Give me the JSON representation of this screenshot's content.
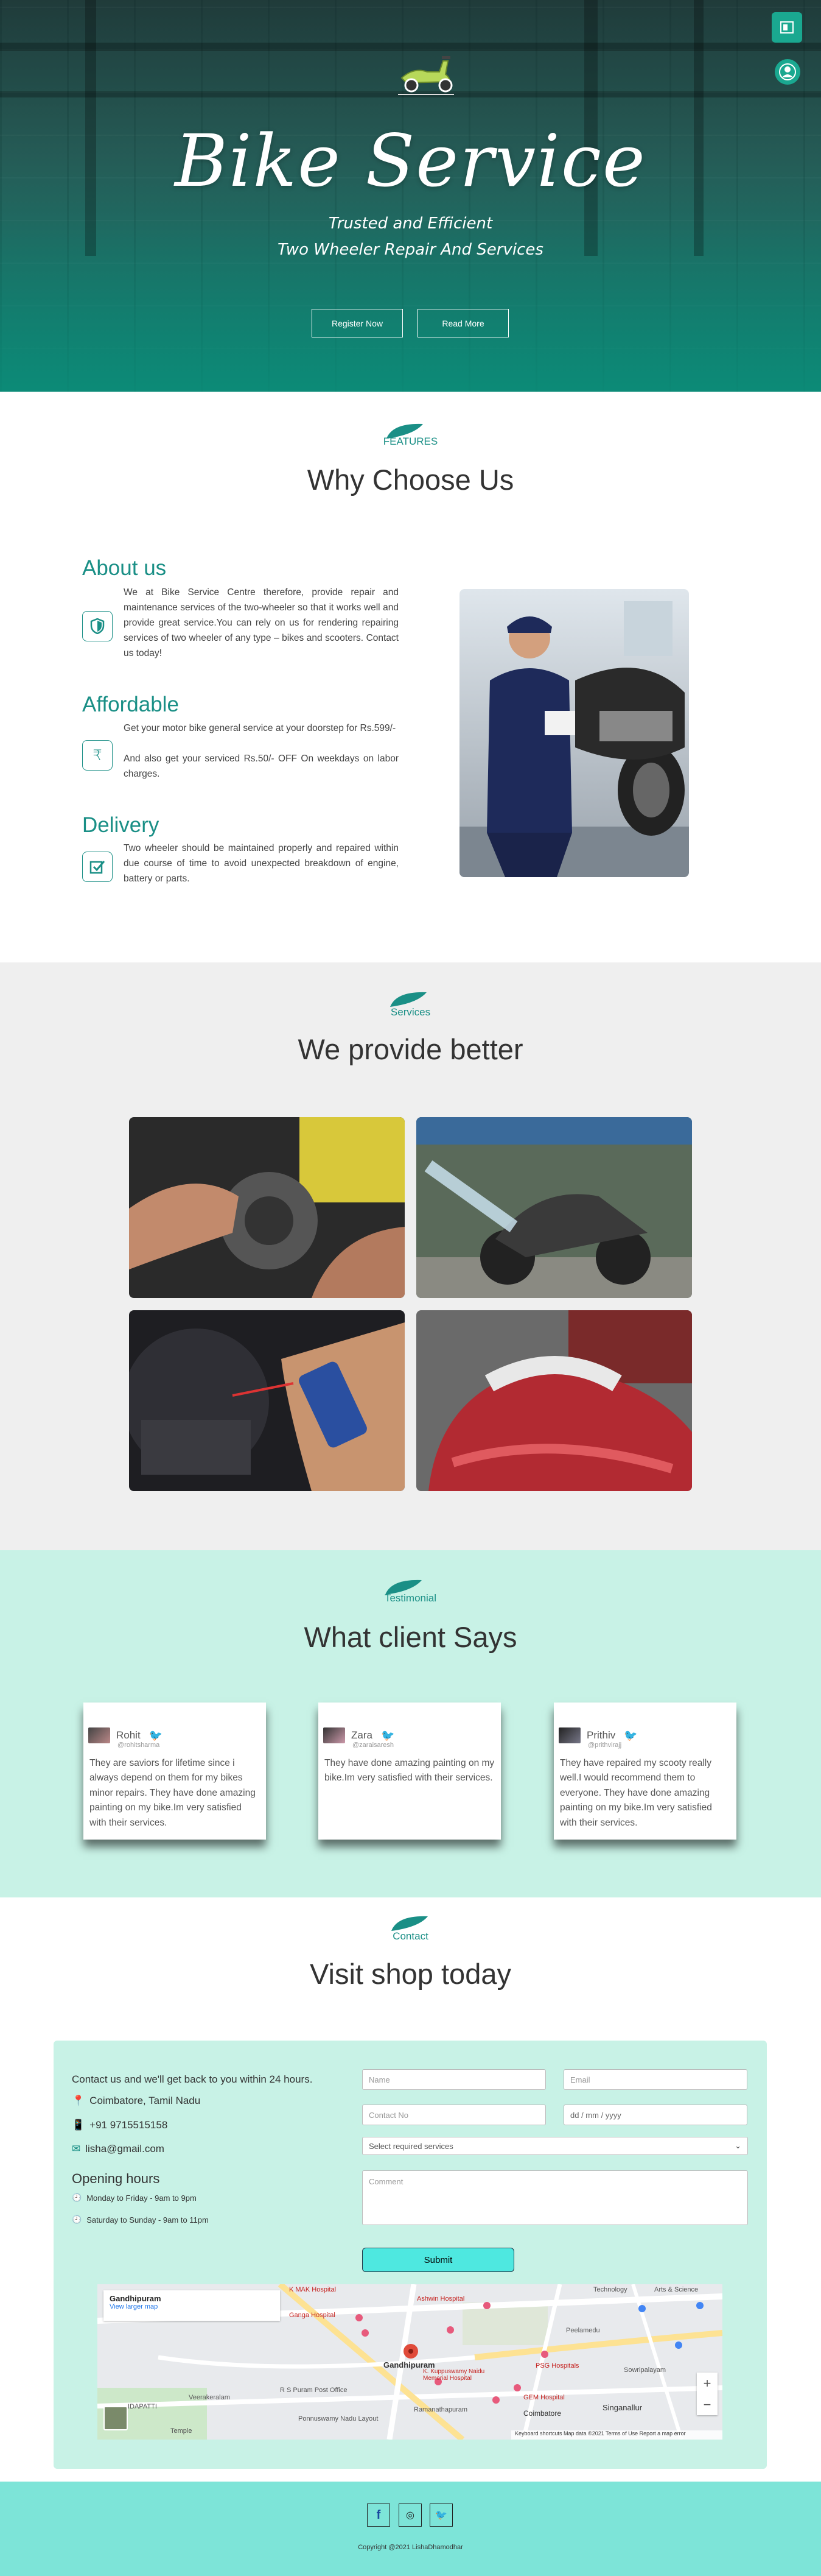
{
  "hero": {
    "title": "Bike Service",
    "subtitle_1": "Trusted and Efficient",
    "subtitle_2": "Two Wheeler Repair And Services",
    "register_button": "Register Now",
    "read_more_button": "Read More",
    "side_buttons": [
      "sidebar-toggle-icon",
      "user-account-icon"
    ]
  },
  "features": {
    "tag": "FEATURES",
    "title": "Why Choose Us",
    "items": [
      {
        "heading": "About us",
        "icon": "shield-icon",
        "text": "We at Bike Service Centre therefore, provide repair and maintenance services of the two-wheeler so that it works well and provide great service.You can rely on us for rendering repairing services of two wheeler of any type – bikes and scooters. Contact us today!"
      },
      {
        "heading": "Affordable",
        "icon": "rupee-icon",
        "text_1": "Get your motor bike general service at your doorstep for Rs.599/-",
        "text_2": "And also get your serviced Rs.50/- OFF On weekdays on labor charges."
      },
      {
        "heading": "Delivery",
        "icon": "checkbox-icon",
        "text": "Two wheeler should be maintained properly and repaired within due course of time to avoid unexpected breakdown of engine, battery or parts."
      }
    ]
  },
  "services": {
    "tag": "Services",
    "title": "We provide better"
  },
  "testimonial": {
    "tag": "Testimonial",
    "title": "What client Says",
    "cards": [
      {
        "name": "Rohit",
        "handle": "@rohitsharma",
        "text": "They are saviors for lifetime since i always depend on them for my bikes minor repairs. They have done amazing painting on my bike.Im very satisfied with their services."
      },
      {
        "name": "Zara",
        "handle": "@zaraisaresh",
        "text": "They have done amazing painting on my bike.Im very satisfied with their services."
      },
      {
        "name": "Prithiv",
        "handle": "@prithvirajj",
        "text": "They have repaired my scooty really well.I would recommend them to everyone. They have done amazing painting on my bike.Im very satisfied with their services."
      }
    ]
  },
  "contact": {
    "tag": "Contact",
    "title": "Visit shop today",
    "intro": "Contact us and we'll get back to you within 24 hours.",
    "address": "Coimbatore, Tamil Nadu",
    "phone": "+91 9715515158",
    "email": "lisha@gmail.com",
    "hours_title": "Opening hours",
    "hours_weekday": "Monday to Friday - 9am to 9pm",
    "hours_weekend": "Saturday to Sunday - 9am to 11pm",
    "form": {
      "name_placeholder": "Name",
      "email_placeholder": "Email",
      "contact_placeholder": "Contact No",
      "date_placeholder": "dd / mm / yyyy",
      "service_select": "Select required services",
      "comment_placeholder": "Comment",
      "submit_label": "Submit"
    },
    "map": {
      "place": "Gandhipuram",
      "larger_map": "View larger map",
      "labels": [
        "Gandhipuram",
        "Technology",
        "Arts & Science",
        "Ashwin Hospital",
        "K MAK Hospital",
        "Ganga Hospital",
        "PSG Hospitals",
        "GEM Hospital",
        "Singanallur",
        "Coimbatore",
        "Peelamedu",
        "R S Puram Post Office",
        "Ponnuswamy Nadu Layout",
        "Veerakeralam",
        "Ramanathapuram",
        "K. Kuppuswamy Naidu Memorial Hospital",
        "Sowripalayam",
        "Temple",
        "IDAPATTI"
      ],
      "attribution": "Keyboard shortcuts  Map data ©2021  Terms of Use  Report a map error"
    }
  },
  "footer": {
    "social": [
      "f",
      "◎",
      "🐦"
    ],
    "copyright": "Copyright @2021 LishaDhamodhar"
  },
  "colors": {
    "accent": "#1a8f86",
    "mint": "#c8f2e6",
    "footer": "#7de4d8",
    "button": "#4ee8e0"
  }
}
